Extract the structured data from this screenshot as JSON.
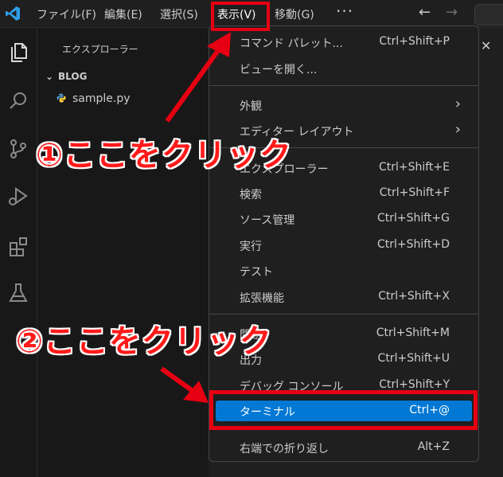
{
  "menubar": {
    "items": [
      "ファイル(F)",
      "編集(E)",
      "選択(S)",
      "表示(V)",
      "移動(G)"
    ],
    "more": "···",
    "back": "←",
    "forward": "→"
  },
  "sidebar": {
    "title": "エクスプローラー",
    "folder": "BLOG",
    "file": "sample.py"
  },
  "view_menu": {
    "items": [
      {
        "label": "コマンド パレット...",
        "shortcut": "Ctrl+Shift+P"
      },
      {
        "label": "ビューを開く...",
        "shortcut": ""
      },
      {
        "label": "外観",
        "shortcut": ""
      },
      {
        "label": "エディター レイアウト",
        "shortcut": ""
      },
      {
        "label": "エクスプローラー",
        "shortcut": "Ctrl+Shift+E"
      },
      {
        "label": "検索",
        "shortcut": "Ctrl+Shift+F"
      },
      {
        "label": "ソース管理",
        "shortcut": "Ctrl+Shift+G"
      },
      {
        "label": "実行",
        "shortcut": "Ctrl+Shift+D"
      },
      {
        "label": "テスト",
        "shortcut": ""
      },
      {
        "label": "拡張機能",
        "shortcut": "Ctrl+Shift+X"
      },
      {
        "label": "問題",
        "shortcut": "Ctrl+Shift+M"
      },
      {
        "label": "出力",
        "shortcut": "Ctrl+Shift+U"
      },
      {
        "label": "デバッグ コンソール",
        "shortcut": "Ctrl+Shift+Y"
      },
      {
        "label": "ターミナル",
        "shortcut": "Ctrl+@"
      },
      {
        "label": "右端での折り返し",
        "shortcut": "Alt+Z"
      }
    ]
  },
  "annotations": {
    "step1": "①ここをクリック",
    "step2": "②ここをクリック"
  },
  "colors": {
    "accent": "#0078d4",
    "annotation": "#e60012",
    "background": "#1f1f1f"
  }
}
